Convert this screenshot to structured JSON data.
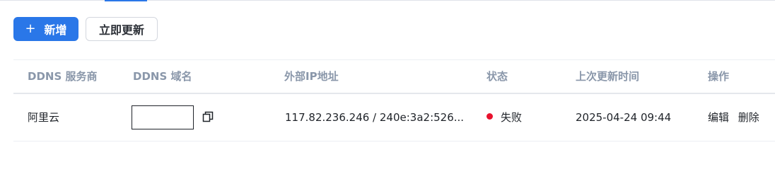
{
  "toolbar": {
    "add_icon": "plus-icon",
    "add_label": "新增",
    "refresh_label": "立即更新"
  },
  "table": {
    "columns": [
      "DDNS 服务商",
      "DDNS 域名",
      "外部IP地址",
      "状态",
      "上次更新时间",
      "操作"
    ],
    "rows": [
      {
        "provider": "阿里云",
        "domain": "",
        "copy_icon": "copy-icon",
        "ip": "117.82.236.246 / 240e:3a2:526...",
        "status": "失败",
        "status_color": "#e8112d",
        "updated": "2025-04-24 09:44",
        "edit_label": "编辑",
        "delete_label": "删除"
      }
    ]
  },
  "colors": {
    "primary": "#2a77e8",
    "header_text": "#8a97aa",
    "status_fail": "#e8112d"
  }
}
